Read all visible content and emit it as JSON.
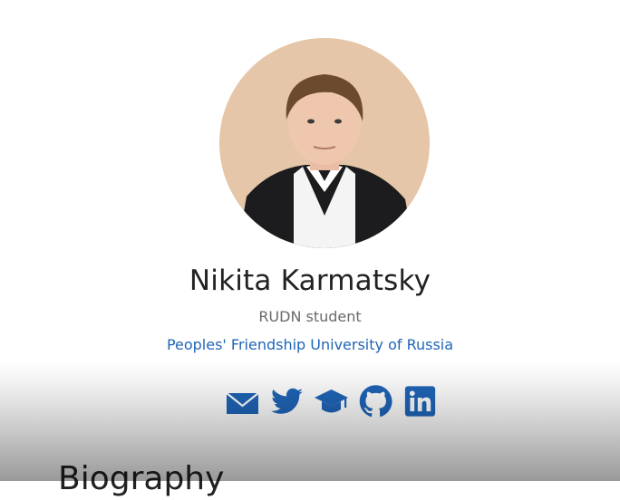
{
  "profile": {
    "name": "Nikita Karmatsky",
    "role": "RUDN student",
    "organization": "Peoples' Friendship University of Russia",
    "avatar_icon": "profile-photo"
  },
  "social_links": [
    {
      "icon": "envelope-icon",
      "label": "Email"
    },
    {
      "icon": "twitter-icon",
      "label": "Twitter"
    },
    {
      "icon": "graduation-cap-icon",
      "label": "Google Scholar"
    },
    {
      "icon": "github-icon",
      "label": "GitHub"
    },
    {
      "icon": "linkedin-icon",
      "label": "LinkedIn"
    }
  ],
  "section": {
    "heading": "Biography"
  },
  "colors": {
    "accent": "#1f65b8",
    "text": "#222222",
    "muted": "#6a6a6a"
  }
}
